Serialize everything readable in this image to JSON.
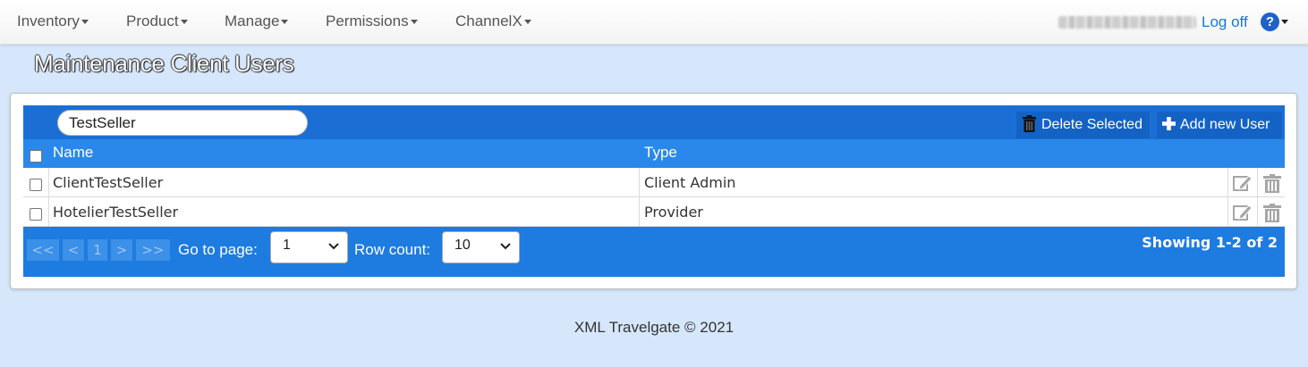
{
  "nav": {
    "items": [
      {
        "label": "Inventory"
      },
      {
        "label": "Product"
      },
      {
        "label": "Manage"
      },
      {
        "label": "Permissions"
      },
      {
        "label": "ChannelX"
      }
    ],
    "logoff_label": "Log off",
    "help_symbol": "?"
  },
  "page": {
    "title": "Maintenance Client Users"
  },
  "toolbar": {
    "search_value": "TestSeller",
    "delete_selected_label": "Delete Selected",
    "add_user_label": "Add new User"
  },
  "table": {
    "columns": [
      "Name",
      "Type"
    ],
    "rows": [
      {
        "name": "ClientTestSeller",
        "type": "Client Admin"
      },
      {
        "name": "HotelierTestSeller",
        "type": "Provider"
      }
    ]
  },
  "pager": {
    "first": "<<",
    "prev": "<",
    "current": "1",
    "next": ">",
    "last": ">>",
    "goto_label": "Go to page:",
    "goto_value": "1",
    "rowcount_label": "Row count:",
    "rowcount_value": "10",
    "showing": "Showing 1-2 of 2"
  },
  "footer": {
    "copyright": "XML Travelgate © 2021"
  },
  "colors": {
    "accent": "#1e7be0",
    "toolbar": "#1b6fd4",
    "header": "#2a88ea",
    "background": "#d6e7fb",
    "link": "#1a77d2"
  }
}
